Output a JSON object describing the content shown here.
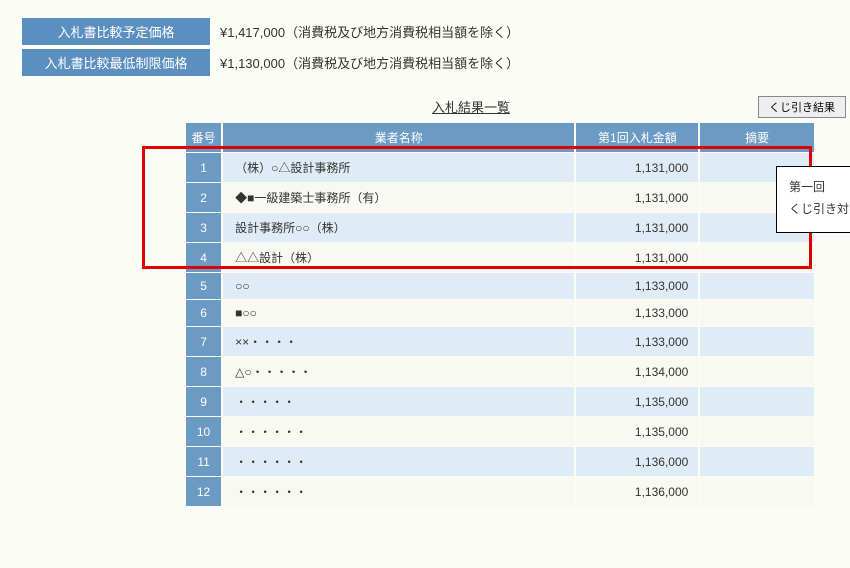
{
  "info": {
    "planned_price_label": "入札書比較予定価格",
    "planned_price_value": "¥1,417,000（消費税及び地方消費税相当額を除く）",
    "min_price_label": "入札書比較最低制限価格",
    "min_price_value": "¥1,130,000（消費税及び地方消費税相当額を除く）"
  },
  "list": {
    "title": "入札結果一覧",
    "kuji_button": "くじ引き結果",
    "headers": {
      "no": "番号",
      "name": "業者名称",
      "amount": "第1回入札金額",
      "tekiyo": "摘要"
    },
    "rows": [
      {
        "no": "1",
        "name": "（株）○△設計事務所",
        "amount": "1,131,000"
      },
      {
        "no": "2",
        "name": "◆■一級建築士事務所（有）",
        "amount": "1,131,000"
      },
      {
        "no": "3",
        "name": "設計事務所○○（株）",
        "amount": "1,131,000"
      },
      {
        "no": "4",
        "name": "△△設計（株）",
        "amount": "1,131,000"
      },
      {
        "no": "5",
        "name": "○○",
        "amount": "1,133,000"
      },
      {
        "no": "6",
        "name": "■○○",
        "amount": "1,133,000"
      },
      {
        "no": "7",
        "name": "××・・・・",
        "amount": "1,133,000"
      },
      {
        "no": "8",
        "name": "△○・・・・・",
        "amount": "1,134,000"
      },
      {
        "no": "9",
        "name": "・・・・・",
        "amount": "1,135,000"
      },
      {
        "no": "10",
        "name": "・・・・・・",
        "amount": "1,135,000"
      },
      {
        "no": "11",
        "name": "・・・・・・",
        "amount": "1,136,000"
      },
      {
        "no": "12",
        "name": "・・・・・・",
        "amount": "1,136,000"
      }
    ]
  },
  "callout": {
    "line1": "第一回",
    "line2": "くじ引き対象者"
  }
}
